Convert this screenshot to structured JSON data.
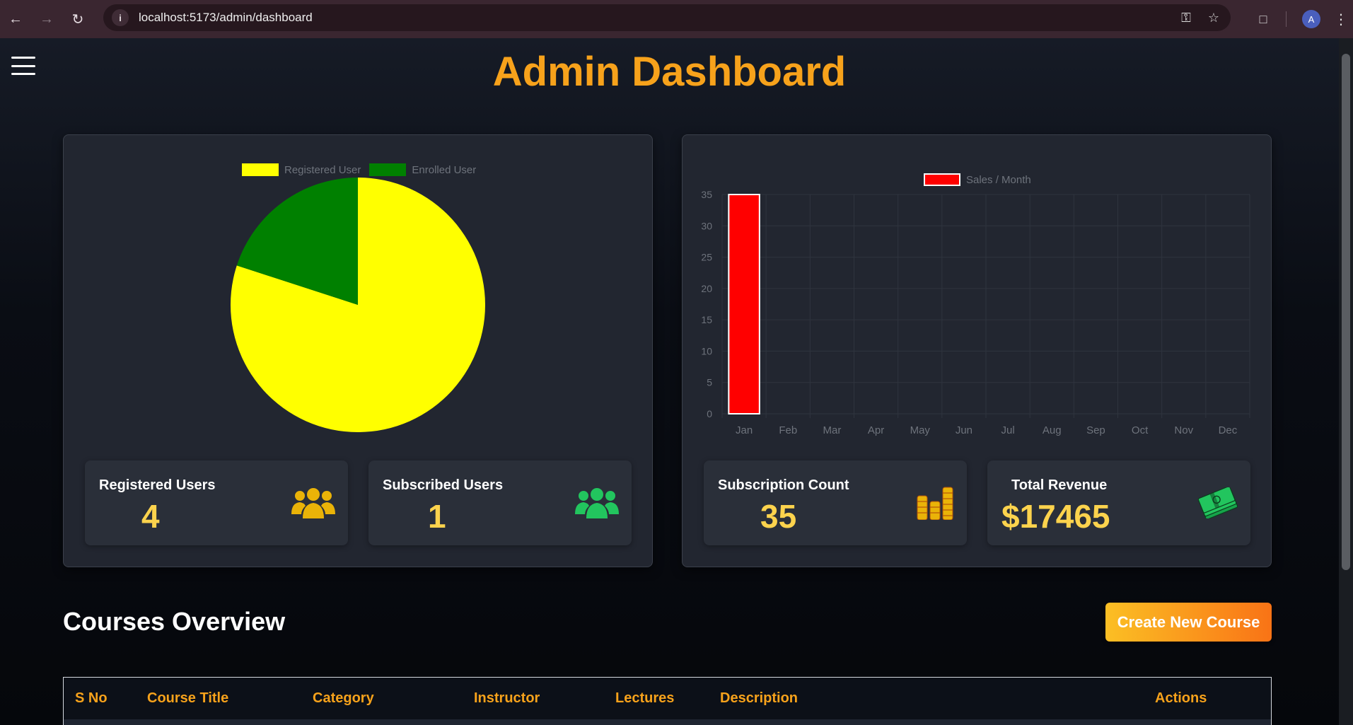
{
  "browser": {
    "url": "localhost:5173/admin/dashboard",
    "profile_initial": "A"
  },
  "page": {
    "title": "Admin Dashboard"
  },
  "user_chart": {
    "chart_data": {
      "type": "pie",
      "labels": [
        "Registered User",
        "Enrolled User"
      ],
      "values": [
        4,
        1
      ],
      "colors": [
        "#ffff00",
        "#008000"
      ]
    }
  },
  "sales_chart": {
    "chart_data": {
      "type": "bar",
      "series": [
        {
          "name": "Sales / Month",
          "values": [
            35,
            0,
            0,
            0,
            0,
            0,
            0,
            0,
            0,
            0,
            0,
            0
          ]
        }
      ],
      "categories": [
        "Jan",
        "Feb",
        "Mar",
        "Apr",
        "May",
        "Jun",
        "Jul",
        "Aug",
        "Sep",
        "Oct",
        "Nov",
        "Dec"
      ],
      "ylim": [
        0,
        35
      ],
      "yticks": [
        "0",
        "5",
        "10",
        "15",
        "20",
        "25",
        "30",
        "35"
      ],
      "bar_color": "#ff0000",
      "grid": true
    }
  },
  "stats": {
    "registered_users": {
      "label": "Registered Users",
      "value": "4",
      "icon": "users-icon",
      "color": "#eab308"
    },
    "subscribed_users": {
      "label": "Subscribed Users",
      "value": "1",
      "icon": "users-icon",
      "color": "#22c55e"
    },
    "subscription_count": {
      "label": "Subscription Count",
      "value": "35",
      "icon": "coins-icon",
      "color": "#eab308"
    },
    "total_revenue": {
      "label": "Total Revenue",
      "value": "$17465",
      "icon": "money-icon",
      "color": "#22c55e"
    }
  },
  "courses": {
    "title": "Courses Overview",
    "create_label": "Create New Course",
    "columns": [
      "S No",
      "Course Title",
      "Category",
      "Instructor",
      "Lectures",
      "Description",
      "Actions"
    ]
  }
}
